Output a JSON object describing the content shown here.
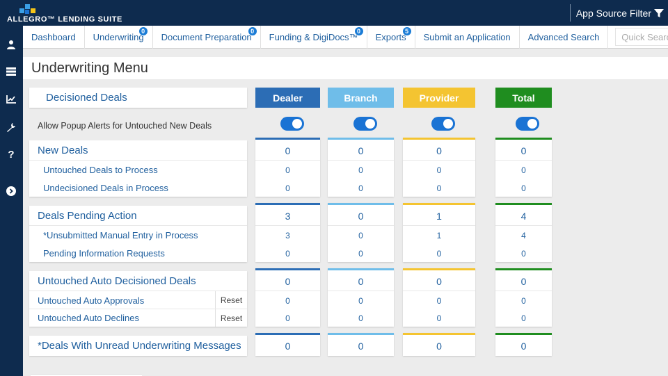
{
  "app": {
    "logo_text": "ALLEGRO™ LENDING SUITE",
    "app_source_filter": "App Source Filter",
    "logo_colors": [
      "#3aa0e6",
      "#f5c518",
      "#1a73d4"
    ]
  },
  "sidebar": {
    "icons": [
      "user-icon",
      "list-icon",
      "chart-icon",
      "wrench-icon",
      "help-icon",
      "chevron-right-circle-icon"
    ]
  },
  "nav": {
    "items": [
      {
        "label": "Dashboard",
        "badge": ""
      },
      {
        "label": "Underwriting",
        "badge": "0"
      },
      {
        "label": "Document Preparation",
        "badge": "0"
      },
      {
        "label": "Funding & DigiDocs™",
        "badge": "0"
      },
      {
        "label": "Exports",
        "badge": "5"
      },
      {
        "label": "Submit an Application",
        "badge": ""
      },
      {
        "label": "Advanced Search",
        "badge": ""
      }
    ],
    "search_placeholder": "Quick Search"
  },
  "page": {
    "title": "Underwriting Menu"
  },
  "columns": {
    "header_label": "Decisioned Deals",
    "dealer": {
      "label": "Dealer",
      "color": "#2c6db5"
    },
    "branch": {
      "label": "Branch",
      "color": "#6fbde9"
    },
    "provider": {
      "label": "Provider",
      "color": "#f4c431"
    },
    "total": {
      "label": "Total",
      "color": "#1f8d1f"
    }
  },
  "popup": {
    "label": "Allow Popup Alerts for Untouched New Deals",
    "dealer": true,
    "branch": true,
    "provider": true,
    "total": true
  },
  "sections": {
    "new_deals": {
      "label": "New Deals",
      "values": {
        "dealer": "0",
        "branch": "0",
        "provider": "0",
        "total": "0"
      },
      "rows": [
        {
          "label": "Untouched Deals to Process",
          "dealer": "0",
          "branch": "0",
          "provider": "0",
          "total": "0"
        },
        {
          "label": "Undecisioned Deals in Process",
          "dealer": "0",
          "branch": "0",
          "provider": "0",
          "total": "0"
        }
      ]
    },
    "pending": {
      "label": "Deals Pending Action",
      "values": {
        "dealer": "3",
        "branch": "0",
        "provider": "1",
        "total": "4"
      },
      "rows": [
        {
          "label": "*Unsubmitted Manual Entry in Process",
          "dealer": "3",
          "branch": "0",
          "provider": "1",
          "total": "4"
        },
        {
          "label": "Pending Information Requests",
          "dealer": "0",
          "branch": "0",
          "provider": "0",
          "total": "0"
        }
      ]
    },
    "auto": {
      "label": "Untouched Auto Decisioned Deals",
      "values": {
        "dealer": "0",
        "branch": "0",
        "provider": "0",
        "total": "0"
      },
      "rows": [
        {
          "label": "Untouched Auto Approvals",
          "reset": "Reset",
          "dealer": "0",
          "branch": "0",
          "provider": "0",
          "total": "0"
        },
        {
          "label": "Untouched Auto Declines",
          "reset": "Reset",
          "dealer": "0",
          "branch": "0",
          "provider": "0",
          "total": "0"
        }
      ]
    },
    "messages": {
      "label": "*Deals With Unread Underwriting Messages",
      "values": {
        "dealer": "0",
        "branch": "0",
        "provider": "0",
        "total": "0"
      }
    }
  }
}
